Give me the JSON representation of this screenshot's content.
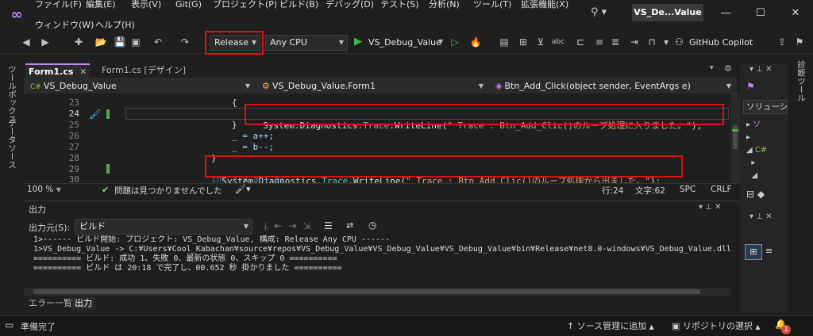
{
  "titlebar": {
    "menus_row1": [
      "ファイル(F)",
      "編集(E)",
      "表示(V)",
      "Git(G)",
      "プロジェクト(P)",
      "ビルド(B)",
      "デバッグ(D)",
      "テスト(S)",
      "分析(N)",
      "ツール(T)",
      "拡張機能(X)"
    ],
    "menus_row2": [
      "ウィンドウ(W)",
      "ヘルプ(H)"
    ],
    "solution_title": "VS_De...Value"
  },
  "toolbar": {
    "config": "Release",
    "platform": "Any CPU",
    "start_target": "VS_Debug_Value",
    "copilot": "GitHub Copilot"
  },
  "left_strip": {
    "toolbox": "ツールボックス",
    "datasource": "データソース"
  },
  "right_strip": {
    "properties": "診断ツール"
  },
  "tabs": {
    "active": "Form1.cs",
    "design": "Form1.cs [デザイン]"
  },
  "navbar": {
    "project": "VS_Debug_Value",
    "class": "VS_Debug_Value.Form1",
    "member": "Btn_Add_Click(object sender, EventArgs e)"
  },
  "editor": {
    "lines": [
      {
        "n": "23",
        "code": "{"
      },
      {
        "n": "24",
        "code": "System.Diagnostics.Trace.WriteLine(\" Trace : Btn_Add_Clic()のループ処理に入りました。\");"
      },
      {
        "n": "25",
        "code": "}"
      },
      {
        "n": "26",
        "code": "_ = a++;"
      },
      {
        "n": "27",
        "code": "_ = b--;"
      },
      {
        "n": "28",
        "code": "}"
      },
      {
        "n": "29",
        "code": "System.Diagnostics.Trace.WriteLine(\" Trace : Btn_Add_Clic()のループ処理から出ました。\");"
      },
      {
        "n": "30",
        "code": "int c = a + b;"
      }
    ],
    "line24": {
      "ns": "System.Diagnostics.",
      "cls": "Trace",
      "method": ".WriteLine(",
      "str": "\" Trace : Btn_Add_Clic()のループ処理に入りました。\"",
      "end": ");"
    },
    "line29": {
      "ns": "System.Diagnostics.",
      "cls": "Trace",
      "method": ".WriteLine(",
      "str": "\" Trace : Btn_Add_Clic()のループ処理から出ました。\"",
      "end": ");"
    }
  },
  "edstatus": {
    "zoom": "100 %",
    "issues": "問題は見つかりませんでした",
    "line": "行:24",
    "col": "文字:62",
    "spc": "SPC",
    "crlf": "CRLF"
  },
  "rightpanel": {
    "solution_tab": "ソリューショ"
  },
  "output": {
    "title": "出力",
    "source_label": "出力元(S):",
    "source_value": "ビルド",
    "lines": [
      "1>------ ビルド開始: プロジェクト: VS_Debug_Value, 構成: Release Any CPU ------",
      "1>VS_Debug_Value -> C:¥Users¥Cool_Kabachan¥source¥repos¥VS_Debug_Value¥VS_Debug_Value¥VS_Debug_Value¥bin¥Release¥net8.0-windows¥VS_Debug_Value.dll",
      "========== ビルド: 成功 1、失敗 0、最新の状態 0、スキップ 0 ==========",
      "========== ビルド は 20:18 で完了し、00.652 秒 掛かりました =========="
    ]
  },
  "bottom_tabs": [
    "エラー一覧",
    "出力"
  ],
  "statusbar": {
    "ready": "準備完了",
    "source_control": "ソース管理に追加",
    "repo": "リポジトリの選択",
    "notif_count": "1"
  }
}
